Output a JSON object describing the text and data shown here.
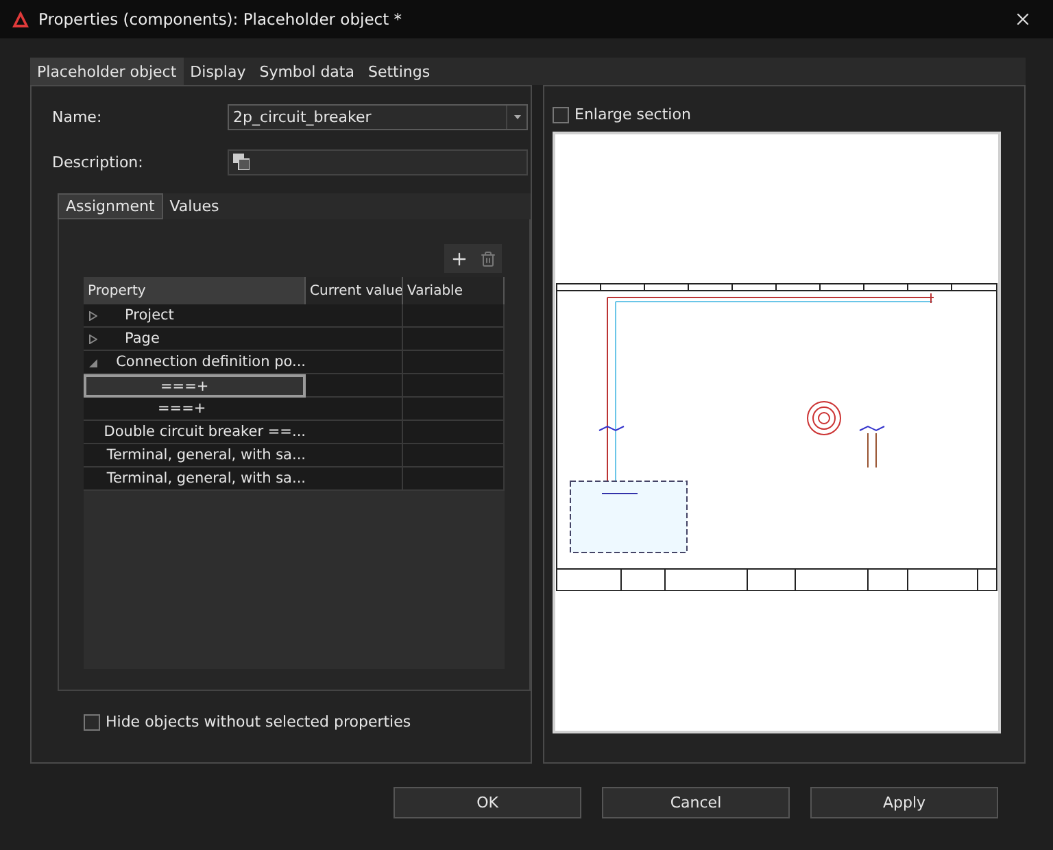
{
  "window": {
    "title": "Properties (components): Placeholder object *"
  },
  "tabs": [
    {
      "label": "Placeholder object",
      "selected": true
    },
    {
      "label": "Display",
      "selected": false
    },
    {
      "label": "Symbol data",
      "selected": false
    },
    {
      "label": "Settings",
      "selected": false
    }
  ],
  "fields": [
    {
      "label": "Name:",
      "value": "2p_circuit_breaker",
      "kind": "combo"
    },
    {
      "label": "Description:",
      "kind": "text"
    }
  ],
  "subtabs": [
    {
      "label": "Assignment",
      "selected": true
    },
    {
      "label": "Values",
      "selected": false
    }
  ],
  "table": {
    "columns": [
      "Property",
      "Current value",
      "Variable"
    ],
    "rows": [
      {
        "label": "Project",
        "expanded": false,
        "selected": false
      },
      {
        "label": "Page",
        "expanded": false,
        "selected": false
      },
      {
        "label": "Connection definition po...",
        "expanded": true,
        "selected": false,
        "children": [
          {
            "label": "===+",
            "selected": true
          },
          {
            "label": "===+",
            "selected": false
          }
        ]
      },
      {
        "label": "Double circuit breaker ==...",
        "selected": false
      },
      {
        "label": "Terminal, general, with sa...",
        "selected": false
      },
      {
        "label": "Terminal, general, with sa...",
        "selected": false
      }
    ]
  },
  "hide_objects": {
    "label": "Hide objects without selected properties",
    "checked": false
  },
  "enlarge": {
    "label": "Enlarge section",
    "checked": false
  },
  "buttons": [
    "OK",
    "Cancel",
    "Apply"
  ]
}
